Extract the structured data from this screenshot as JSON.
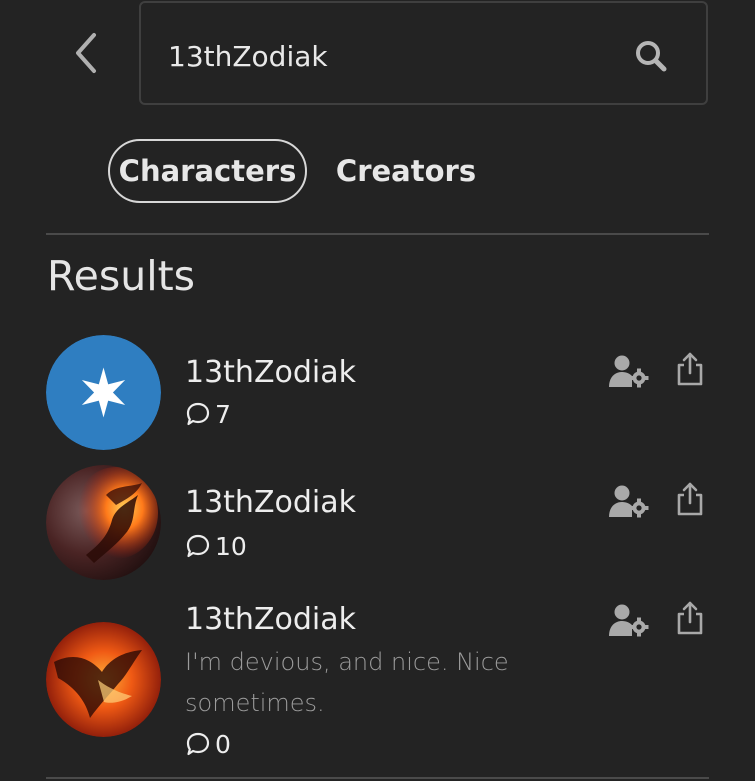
{
  "search": {
    "value": "13thZodiak",
    "placeholder": ""
  },
  "tabs": [
    {
      "label": "Characters",
      "active": true
    },
    {
      "label": "Creators",
      "active": false
    }
  ],
  "results_heading": "Results",
  "results": [
    {
      "name": "13thZodiak",
      "description": "",
      "chat_count": "7",
      "avatar": "blue-star-avatar"
    },
    {
      "name": "13thZodiak",
      "description": "",
      "chat_count": "10",
      "avatar": "fire-dragon-avatar"
    },
    {
      "name": "13thZodiak",
      "description": "I'm devious, and nice. Nice sometimes.",
      "chat_count": "0",
      "avatar": "fire-dragon-avatar"
    }
  ],
  "icons": {
    "back": "chevron-left-icon",
    "search": "search-icon",
    "chat": "chat-bubble-icon",
    "manage": "user-gear-icon",
    "share": "share-icon"
  },
  "colors": {
    "background": "#232323",
    "accent_blue": "#2f7ec1",
    "icon_gray": "#a9a9a9"
  }
}
